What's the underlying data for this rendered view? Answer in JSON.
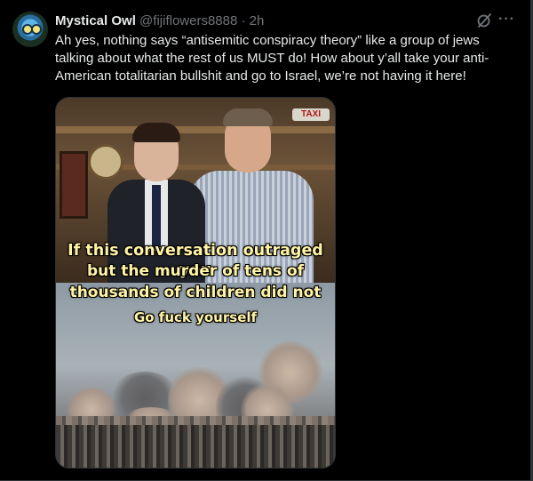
{
  "post": {
    "display_name": "Mystical Owl",
    "handle": "@fijiflowers8888",
    "separator": "·",
    "time": "2h",
    "text": "Ah yes, nothing says “antisemitic conspiracy theory” like a group of jews talking about what the rest of us MUST do! How about y’all take your anti-American totalitarian bullshit and go to Israel, we’re not having it here!"
  },
  "icons": {
    "avatar": "owl-avatar",
    "grok": "grok-icon",
    "more": "more-icon"
  },
  "media": {
    "sign_text": "TAXI",
    "caption_lines": [
      "If this conversation outraged you",
      "but the murder of tens of",
      "thousands of children did not",
      "Go fuck yourself"
    ]
  },
  "colors": {
    "background": "#000000",
    "text": "#e7e9ea",
    "secondary": "#71767b",
    "border": "#2f3336",
    "caption": "#fff3a6"
  }
}
